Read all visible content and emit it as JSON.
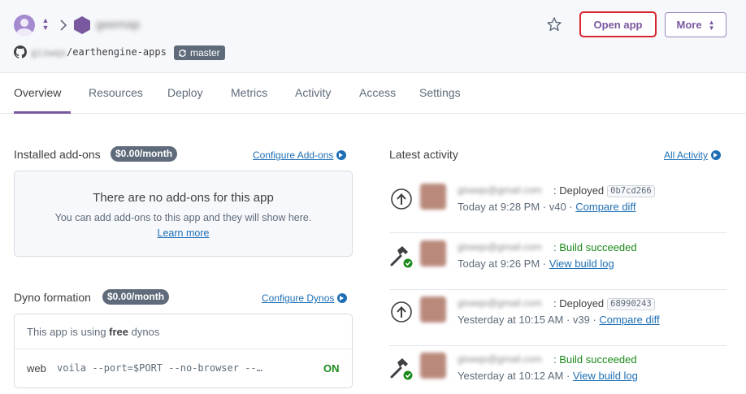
{
  "header": {
    "app_name": "geemap",
    "repo_owner": "giswqs",
    "repo_name": "/earthengine-apps",
    "branch": "master",
    "open_app_label": "Open app",
    "more_label": "More"
  },
  "tabs": [
    {
      "label": "Overview"
    },
    {
      "label": "Resources"
    },
    {
      "label": "Deploy"
    },
    {
      "label": "Metrics"
    },
    {
      "label": "Activity"
    },
    {
      "label": "Access"
    },
    {
      "label": "Settings"
    }
  ],
  "addons": {
    "title": "Installed add-ons",
    "price": "$0.00/month",
    "configure_label": "Configure Add-ons",
    "empty_title": "There are no add-ons for this app",
    "empty_text": "You can add add-ons to this app and they will show here.",
    "learn_more": "Learn more"
  },
  "dynos": {
    "title": "Dyno formation",
    "price": "$0.00/month",
    "configure_label": "Configure Dynos",
    "note_prefix": "This app is using ",
    "note_bold": "free",
    "note_suffix": " dynos",
    "type": "web",
    "command": "voila --port=$PORT --no-browser --…",
    "status": "ON"
  },
  "activity": {
    "title": "Latest activity",
    "all_label": "All Activity",
    "items": [
      {
        "email": "giswqs@gmail.com",
        "action": ": Deployed",
        "kind": "deploy",
        "commit": "0b7cd266",
        "time": "Today at 9:28 PM",
        "sep": " · v40 · ",
        "link": "Compare diff"
      },
      {
        "email": "giswqs@gmail.com",
        "action": ": Build succeeded",
        "kind": "build",
        "commit": "",
        "time": "Today at 9:26 PM",
        "sep": " · ",
        "link": "View build log"
      },
      {
        "email": "giswqs@gmail.com",
        "action": ": Deployed",
        "kind": "deploy",
        "commit": "68990243",
        "time": "Yesterday at 10:15 AM",
        "sep": " · v39 · ",
        "link": "Compare diff"
      },
      {
        "email": "giswqs@gmail.com",
        "action": ": Build succeeded",
        "kind": "build",
        "commit": "",
        "time": "Yesterday at 10:12 AM",
        "sep": " · ",
        "link": "View build log"
      }
    ]
  },
  "colors": {
    "accent": "#79589f",
    "link": "#1e6fb5",
    "success": "#1b8a1b",
    "highlight_outline": "#d8262c"
  },
  "icons": [
    "user-avatar-icon",
    "chevron-updown-icon",
    "chevron-right-icon",
    "hexagon-app-icon",
    "github-icon",
    "sync-icon",
    "star-icon",
    "upload-cloud-icon",
    "hammer-check-icon",
    "circle-arrow-right-icon"
  ]
}
